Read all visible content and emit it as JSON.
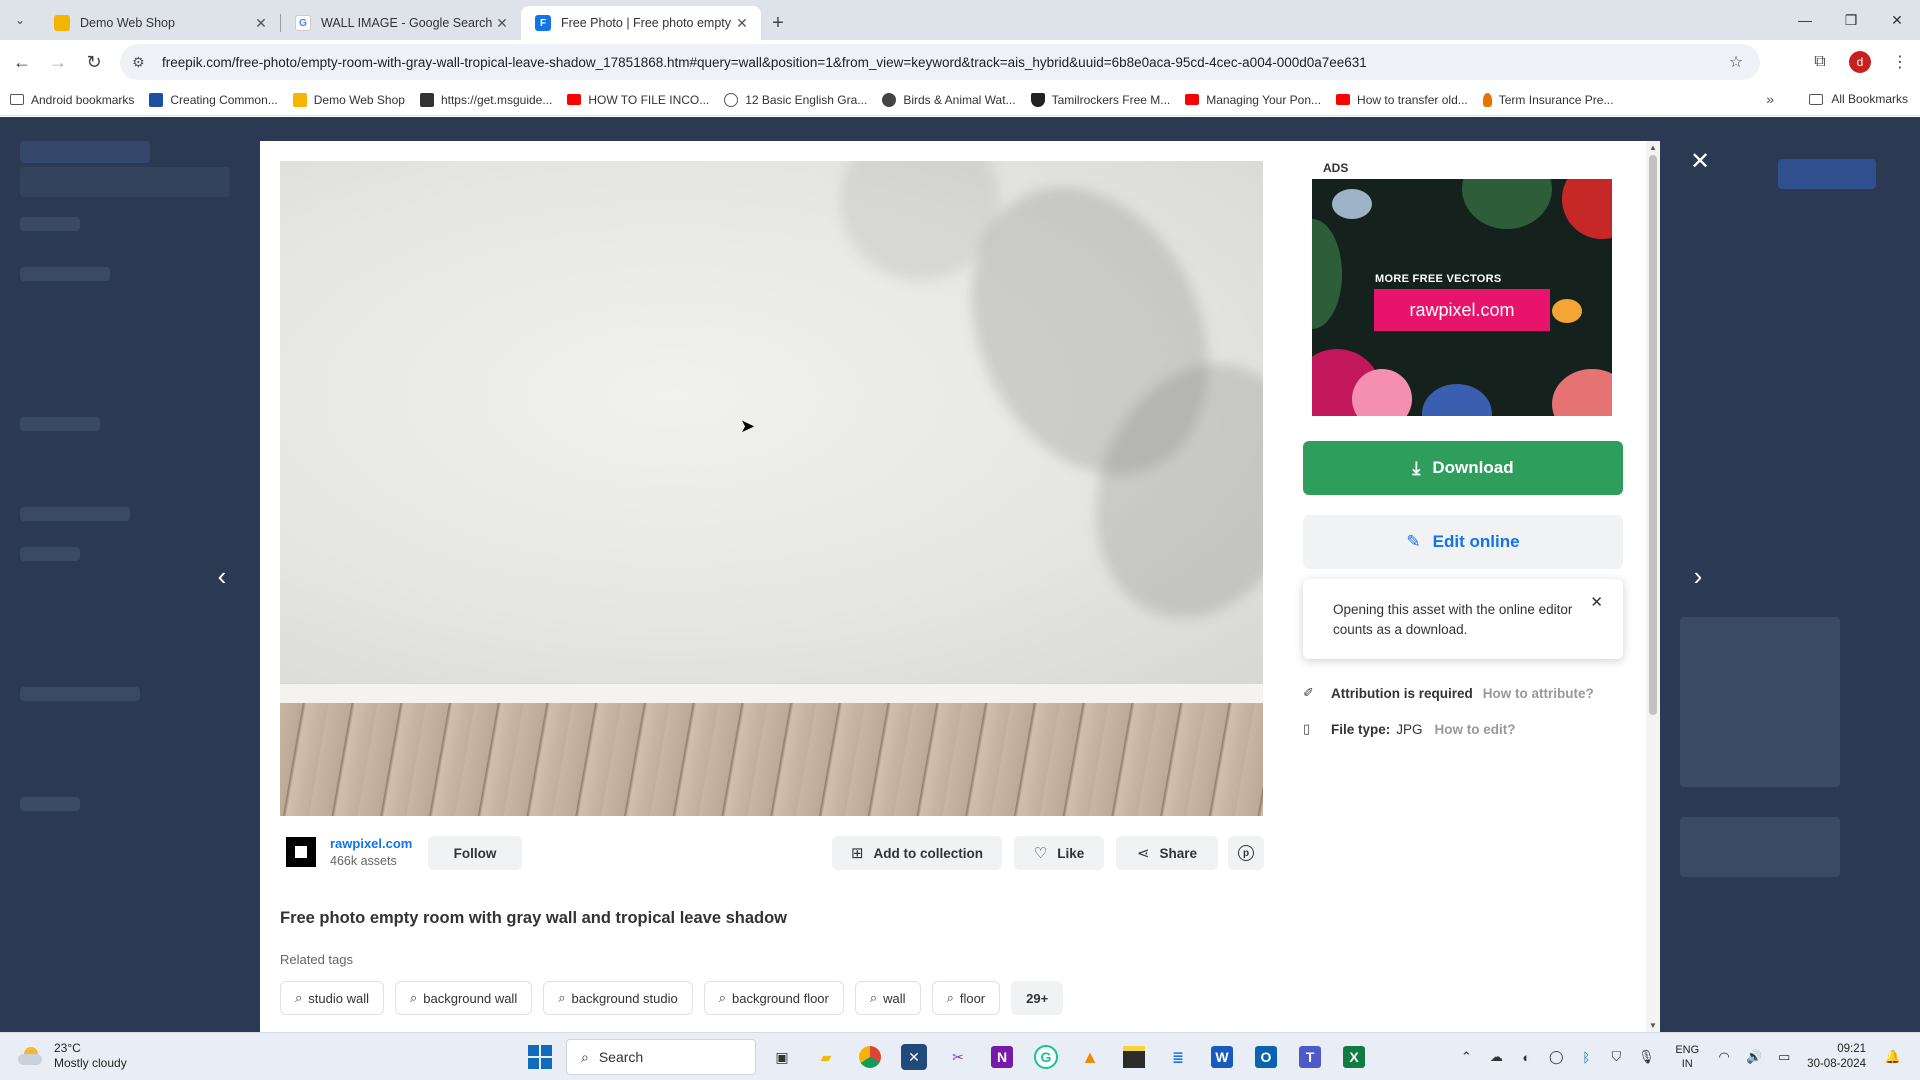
{
  "browser": {
    "tabs": [
      {
        "title": "Demo Web Shop",
        "favicon_color": "#f4b400",
        "active": false
      },
      {
        "title": "WALL IMAGE - Google Search",
        "favicon_color": "#4285f4",
        "active": false
      },
      {
        "title": "Free Photo | Free photo empty",
        "favicon_color": "#1273eb",
        "active": true
      }
    ],
    "new_tab_glyph": "+",
    "url": "freepik.com/free-photo/empty-room-with-gray-wall-tropical-leave-shadow_17851868.htm#query=wall&position=1&from_view=keyword&track=ais_hybrid&uuid=6b8e0aca-95cd-4cec-a004-000d0a7ee631",
    "profile_initial": "d",
    "bookmarks": [
      {
        "label": "Android bookmarks",
        "icon": "folder-icon",
        "color": "#555555"
      },
      {
        "label": "Creating Common...",
        "icon": "creative-commons-icon",
        "color": "#1a4fa3"
      },
      {
        "label": "Demo Web Shop",
        "icon": "shop-icon",
        "color": "#f4b400"
      },
      {
        "label": "https://get.msguide...",
        "icon": "msguide-icon",
        "color": "#333333"
      },
      {
        "label": "HOW TO FILE INCO...",
        "icon": "youtube-icon",
        "color": "#ff0000"
      },
      {
        "label": "12 Basic English Gra...",
        "icon": "globe-icon",
        "color": "#555555"
      },
      {
        "label": "Birds & Animal Wat...",
        "icon": "bird-icon",
        "color": "#444444"
      },
      {
        "label": "Tamilrockers Free M...",
        "icon": "shield-icon",
        "color": "#222222"
      },
      {
        "label": "Managing Your Pon...",
        "icon": "youtube-icon",
        "color": "#ff0000"
      },
      {
        "label": "How to transfer old...",
        "icon": "youtube-icon",
        "color": "#ff0000"
      },
      {
        "label": "Term Insurance Pre...",
        "icon": "flame-icon",
        "color": "#e37400"
      }
    ],
    "bookmarks_more": "»",
    "all_bookmarks": "All Bookmarks"
  },
  "modal": {
    "close_glyph": "✕",
    "author": {
      "name": "rawpixel.com",
      "assets": "466k assets",
      "follow_label": "Follow"
    },
    "actions": {
      "add_to_collection": "Add to collection",
      "like": "Like",
      "share": "Share"
    },
    "title": "Free photo empty room with gray wall and tropical leave shadow",
    "related_label": "Related tags",
    "tags": [
      "studio wall",
      "background wall",
      "background studio",
      "background floor",
      "wall",
      "floor"
    ],
    "tags_more": "29+",
    "ads_label": "ADS",
    "ad": {
      "headline": "MORE FREE VECTORS",
      "button": "rawpixel.com",
      "accent": "#e8136b"
    },
    "download_label": "Download",
    "download_color": "#2f9e5c",
    "edit_label": "Edit online",
    "tooltip": "Opening this asset with the online editor counts as a download.",
    "attribution": {
      "label": "Attribution is required",
      "link": "How to attribute?"
    },
    "file_type": {
      "label": "File type:",
      "value": "JPG",
      "link": "How to edit?"
    }
  },
  "taskbar": {
    "weather_temp": "23°C",
    "weather_desc": "Mostly cloudy",
    "search_label": "Search",
    "language_line1": "ENG",
    "language_line2": "IN",
    "time": "09:21",
    "date": "30-08-2024"
  }
}
